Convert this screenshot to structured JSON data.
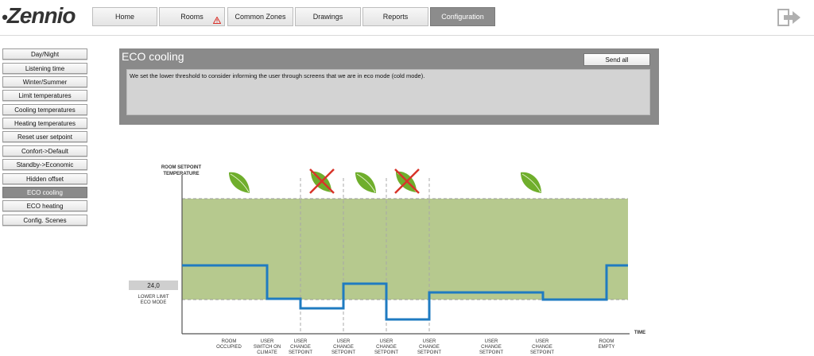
{
  "app": {
    "logo_text": "Zennio"
  },
  "nav": {
    "tabs": [
      {
        "label": "Home",
        "active": false
      },
      {
        "label": "Rooms",
        "active": false,
        "warning": true
      },
      {
        "label": "Common Zones",
        "active": false
      },
      {
        "label": "Drawings",
        "active": false
      },
      {
        "label": "Reports",
        "active": false
      },
      {
        "label": "Configuration",
        "active": true
      }
    ]
  },
  "sidebar": {
    "items": [
      {
        "label": "Day/Night",
        "active": false
      },
      {
        "label": "Listening time",
        "active": false
      },
      {
        "label": "Winter/Summer",
        "active": false
      },
      {
        "label": "Limit temperatures",
        "active": false
      },
      {
        "label": "Cooling temperatures",
        "active": false
      },
      {
        "label": "Heating temperatures",
        "active": false
      },
      {
        "label": "Reset user setpoint",
        "active": false
      },
      {
        "label": "Confort->Default",
        "active": false
      },
      {
        "label": "Standby->Economic",
        "active": false
      },
      {
        "label": "Hidden offset",
        "active": false
      },
      {
        "label": "ECO cooling",
        "active": true
      },
      {
        "label": "ECO heating",
        "active": false
      },
      {
        "label": "Config. Scenes",
        "active": false
      }
    ]
  },
  "panel": {
    "title": "ECO cooling",
    "send_all_label": "Send all",
    "description": "We set the lower threshold to consider informing the user through screens that we are in eco mode (cold mode)."
  },
  "diagram": {
    "y_axis_label_line1": "ROOM SETPOINT",
    "y_axis_label_line2": "TEMPERATURE",
    "x_axis_label": "TIME",
    "lower_limit_value": "24,0",
    "lower_limit_label_line1": "LOWER LIMIT",
    "lower_limit_label_line2": "ECO MODE",
    "events": [
      {
        "line1": "ROOM",
        "line2": "OCCUPIED",
        "line3": ""
      },
      {
        "line1": "USER",
        "line2": "SWITCH ON",
        "line3": "CLIMATE"
      },
      {
        "line1": "USER",
        "line2": "CHANGE",
        "line3": "SETPOINT"
      },
      {
        "line1": "USER",
        "line2": "CHANGE",
        "line3": "SETPOINT"
      },
      {
        "line1": "USER",
        "line2": "CHANGE",
        "line3": "SETPOINT"
      },
      {
        "line1": "USER",
        "line2": "CHANGE",
        "line3": "SETPOINT"
      },
      {
        "line1": "USER",
        "line2": "CHANGE",
        "line3": "SETPOINT"
      },
      {
        "line1": "USER",
        "line2": "CHANGE",
        "line3": "SETPOINT"
      },
      {
        "line1": "ROOM",
        "line2": "EMPTY",
        "line3": ""
      }
    ],
    "icons": [
      "leaf-icon",
      "crossed-leaf-icon",
      "leaf-icon",
      "crossed-leaf-icon",
      "leaf-icon"
    ],
    "colors": {
      "zone": "#b6c98e",
      "line": "#1f7bc1",
      "cross": "#d8342a",
      "leaf": "#6fae2c"
    }
  }
}
